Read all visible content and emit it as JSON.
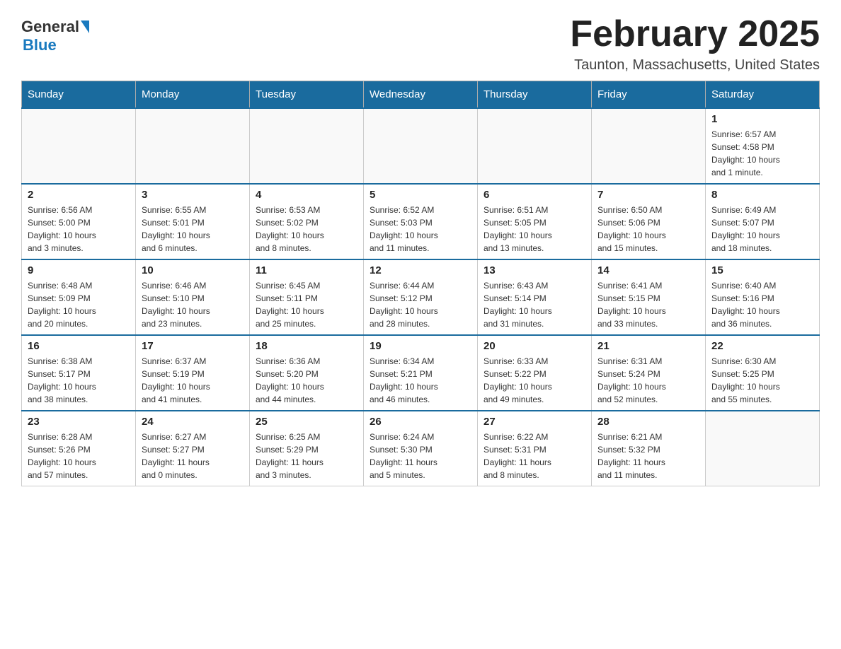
{
  "header": {
    "logo_general": "General",
    "logo_blue": "Blue",
    "month_title": "February 2025",
    "location": "Taunton, Massachusetts, United States"
  },
  "days_of_week": [
    "Sunday",
    "Monday",
    "Tuesday",
    "Wednesday",
    "Thursday",
    "Friday",
    "Saturday"
  ],
  "weeks": [
    [
      {
        "day": "",
        "info": ""
      },
      {
        "day": "",
        "info": ""
      },
      {
        "day": "",
        "info": ""
      },
      {
        "day": "",
        "info": ""
      },
      {
        "day": "",
        "info": ""
      },
      {
        "day": "",
        "info": ""
      },
      {
        "day": "1",
        "info": "Sunrise: 6:57 AM\nSunset: 4:58 PM\nDaylight: 10 hours\nand 1 minute."
      }
    ],
    [
      {
        "day": "2",
        "info": "Sunrise: 6:56 AM\nSunset: 5:00 PM\nDaylight: 10 hours\nand 3 minutes."
      },
      {
        "day": "3",
        "info": "Sunrise: 6:55 AM\nSunset: 5:01 PM\nDaylight: 10 hours\nand 6 minutes."
      },
      {
        "day": "4",
        "info": "Sunrise: 6:53 AM\nSunset: 5:02 PM\nDaylight: 10 hours\nand 8 minutes."
      },
      {
        "day": "5",
        "info": "Sunrise: 6:52 AM\nSunset: 5:03 PM\nDaylight: 10 hours\nand 11 minutes."
      },
      {
        "day": "6",
        "info": "Sunrise: 6:51 AM\nSunset: 5:05 PM\nDaylight: 10 hours\nand 13 minutes."
      },
      {
        "day": "7",
        "info": "Sunrise: 6:50 AM\nSunset: 5:06 PM\nDaylight: 10 hours\nand 15 minutes."
      },
      {
        "day": "8",
        "info": "Sunrise: 6:49 AM\nSunset: 5:07 PM\nDaylight: 10 hours\nand 18 minutes."
      }
    ],
    [
      {
        "day": "9",
        "info": "Sunrise: 6:48 AM\nSunset: 5:09 PM\nDaylight: 10 hours\nand 20 minutes."
      },
      {
        "day": "10",
        "info": "Sunrise: 6:46 AM\nSunset: 5:10 PM\nDaylight: 10 hours\nand 23 minutes."
      },
      {
        "day": "11",
        "info": "Sunrise: 6:45 AM\nSunset: 5:11 PM\nDaylight: 10 hours\nand 25 minutes."
      },
      {
        "day": "12",
        "info": "Sunrise: 6:44 AM\nSunset: 5:12 PM\nDaylight: 10 hours\nand 28 minutes."
      },
      {
        "day": "13",
        "info": "Sunrise: 6:43 AM\nSunset: 5:14 PM\nDaylight: 10 hours\nand 31 minutes."
      },
      {
        "day": "14",
        "info": "Sunrise: 6:41 AM\nSunset: 5:15 PM\nDaylight: 10 hours\nand 33 minutes."
      },
      {
        "day": "15",
        "info": "Sunrise: 6:40 AM\nSunset: 5:16 PM\nDaylight: 10 hours\nand 36 minutes."
      }
    ],
    [
      {
        "day": "16",
        "info": "Sunrise: 6:38 AM\nSunset: 5:17 PM\nDaylight: 10 hours\nand 38 minutes."
      },
      {
        "day": "17",
        "info": "Sunrise: 6:37 AM\nSunset: 5:19 PM\nDaylight: 10 hours\nand 41 minutes."
      },
      {
        "day": "18",
        "info": "Sunrise: 6:36 AM\nSunset: 5:20 PM\nDaylight: 10 hours\nand 44 minutes."
      },
      {
        "day": "19",
        "info": "Sunrise: 6:34 AM\nSunset: 5:21 PM\nDaylight: 10 hours\nand 46 minutes."
      },
      {
        "day": "20",
        "info": "Sunrise: 6:33 AM\nSunset: 5:22 PM\nDaylight: 10 hours\nand 49 minutes."
      },
      {
        "day": "21",
        "info": "Sunrise: 6:31 AM\nSunset: 5:24 PM\nDaylight: 10 hours\nand 52 minutes."
      },
      {
        "day": "22",
        "info": "Sunrise: 6:30 AM\nSunset: 5:25 PM\nDaylight: 10 hours\nand 55 minutes."
      }
    ],
    [
      {
        "day": "23",
        "info": "Sunrise: 6:28 AM\nSunset: 5:26 PM\nDaylight: 10 hours\nand 57 minutes."
      },
      {
        "day": "24",
        "info": "Sunrise: 6:27 AM\nSunset: 5:27 PM\nDaylight: 11 hours\nand 0 minutes."
      },
      {
        "day": "25",
        "info": "Sunrise: 6:25 AM\nSunset: 5:29 PM\nDaylight: 11 hours\nand 3 minutes."
      },
      {
        "day": "26",
        "info": "Sunrise: 6:24 AM\nSunset: 5:30 PM\nDaylight: 11 hours\nand 5 minutes."
      },
      {
        "day": "27",
        "info": "Sunrise: 6:22 AM\nSunset: 5:31 PM\nDaylight: 11 hours\nand 8 minutes."
      },
      {
        "day": "28",
        "info": "Sunrise: 6:21 AM\nSunset: 5:32 PM\nDaylight: 11 hours\nand 11 minutes."
      },
      {
        "day": "",
        "info": ""
      }
    ]
  ]
}
